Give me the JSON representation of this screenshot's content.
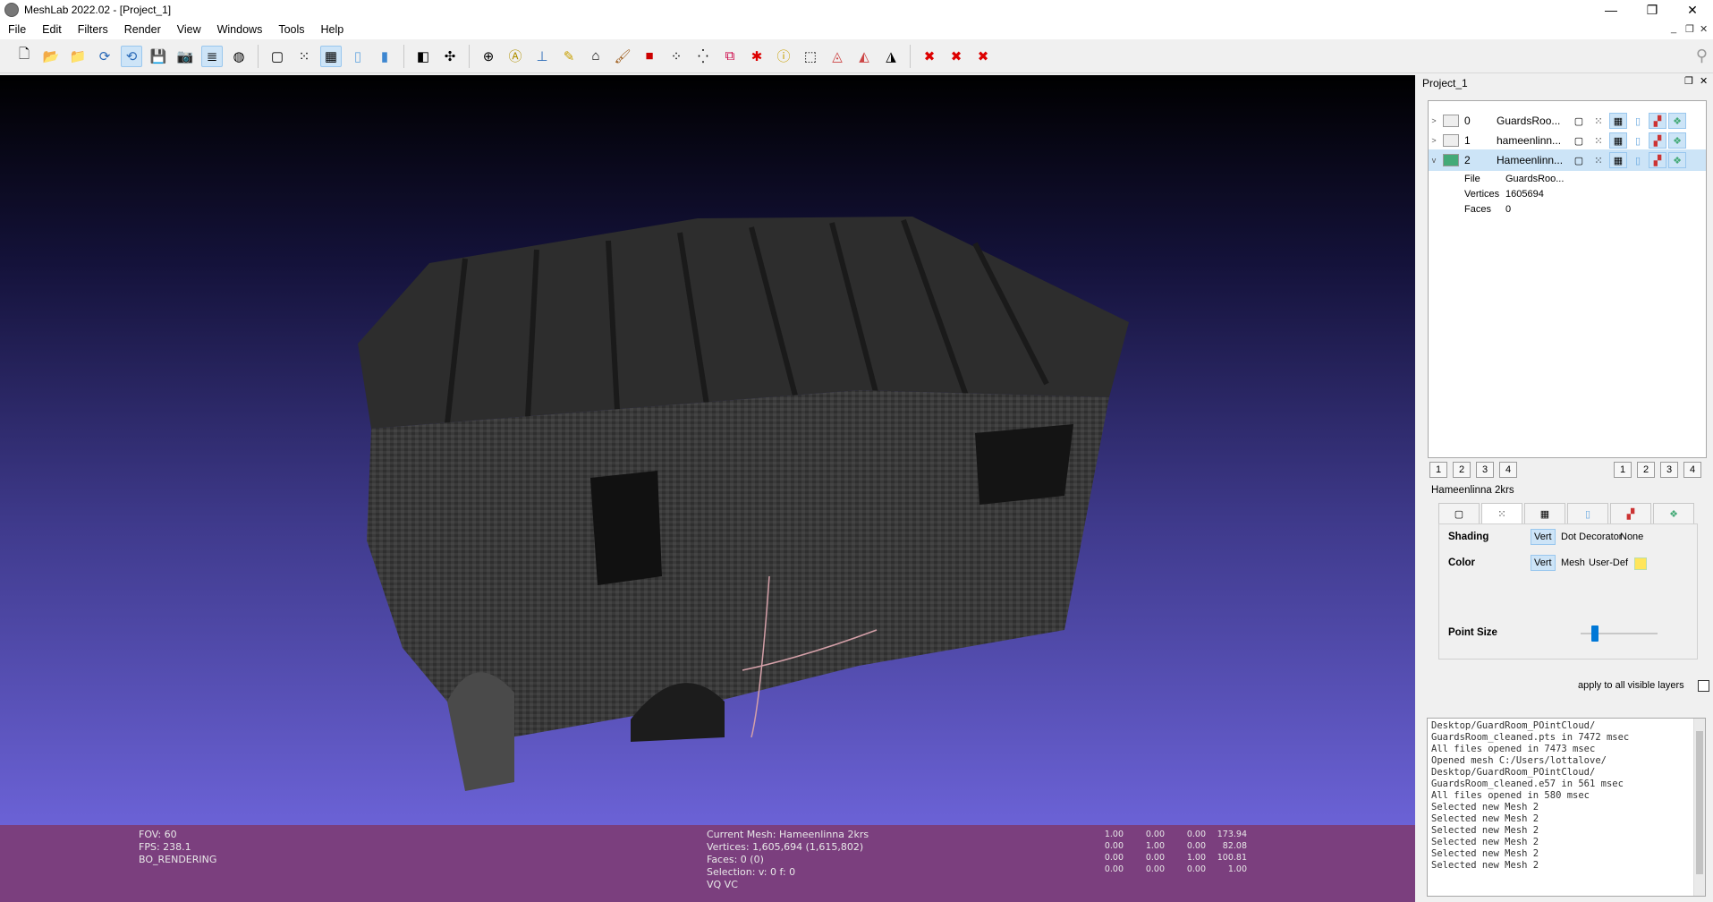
{
  "window": {
    "title": "MeshLab 2022.02 - [Project_1]",
    "minimize": "—",
    "restore": "❐",
    "close": "✕"
  },
  "menu": [
    "File",
    "Edit",
    "Filters",
    "Render",
    "View",
    "Windows",
    "Tools",
    "Help"
  ],
  "toolbar_icons": [
    "new-project-icon",
    "open-project-icon",
    "import-mesh-icon",
    "reload-icon",
    "reload-all-icon",
    "export-mesh-icon",
    "snapshot-icon",
    "layer-dialog-icon",
    "raster-icon",
    "bbox-icon",
    "points-icon",
    "wireframe-icon",
    "flat-icon",
    "smooth-icon",
    "layer-icon",
    "trackball-icon",
    "rotate-icon",
    "annotate-icon",
    "axes-icon",
    "paint-icon",
    "measure-icon",
    "brush-icon",
    "pickpoints-icon",
    "select-vertices-icon",
    "select-faces-icon",
    "mutual-align-icon",
    "georef-icon",
    "info-icon",
    "select-faces-rect-icon",
    "select-verts-icon",
    "select-conn-icon",
    "delete-icon",
    "delete-faces-icon",
    "delete-verts-icon"
  ],
  "hud": {
    "fov": "FOV: 60",
    "fps": "FPS:   238.1",
    "rendering": "BO_RENDERING",
    "current_mesh": "Current Mesh: Hameenlinna 2krs",
    "vertices": "Vertices: 1,605,694    (1,615,802)",
    "faces": "Faces: 0    (0)",
    "selection": "Selection: v: 0 f: 0",
    "vq": "VQ VC",
    "matrix": [
      [
        "1.00",
        "0.00",
        "0.00",
        "173.94"
      ],
      [
        "0.00",
        "1.00",
        "0.00",
        "82.08"
      ],
      [
        "0.00",
        "0.00",
        "1.00",
        "100.81"
      ],
      [
        "0.00",
        "0.00",
        "0.00",
        "1.00"
      ]
    ]
  },
  "panel": {
    "title": "Project_1",
    "layers": [
      {
        "arrow": ">",
        "index": "0",
        "name": "GuardsRoo...",
        "selected": false
      },
      {
        "arrow": ">",
        "index": "1",
        "name": "hameenlinn...",
        "selected": false
      },
      {
        "arrow": "v",
        "index": "2",
        "name": "Hameenlinn...",
        "selected": true
      }
    ],
    "details": [
      {
        "key": "File",
        "value": "GuardsRoo..."
      },
      {
        "key": "Vertices",
        "value": "1605694"
      },
      {
        "key": "Faces",
        "value": "0"
      }
    ],
    "view_buttons_left": [
      "1",
      "2",
      "3",
      "4"
    ],
    "view_buttons_right": [
      "1",
      "2",
      "3",
      "4"
    ],
    "render_title": "Hameenlinna 2krs",
    "shading_label": "Shading",
    "shading_options": [
      "Vert",
      "Dot Decorator",
      "None"
    ],
    "color_label": "Color",
    "color_options": [
      "Vert",
      "Mesh",
      "User-Def"
    ],
    "point_size_label": "Point Size",
    "point_size_fraction": 0.15,
    "user_color": "#ffe55a",
    "apply_label": "apply to all visible layers"
  },
  "log": [
    "Desktop/GuardRoom_POintCloud/",
    "GuardsRoom_cleaned.pts in 7472 msec",
    "All files opened in 7473 msec",
    "Opened mesh C:/Users/lottalove/",
    "Desktop/GuardRoom_POintCloud/",
    "GuardsRoom_cleaned.e57 in 561 msec",
    "All files opened in 580 msec",
    "Selected new Mesh 2",
    "Selected new Mesh 2",
    "Selected new Mesh 2",
    "Selected new Mesh 2",
    "Selected new Mesh 2",
    "Selected new Mesh 2"
  ]
}
